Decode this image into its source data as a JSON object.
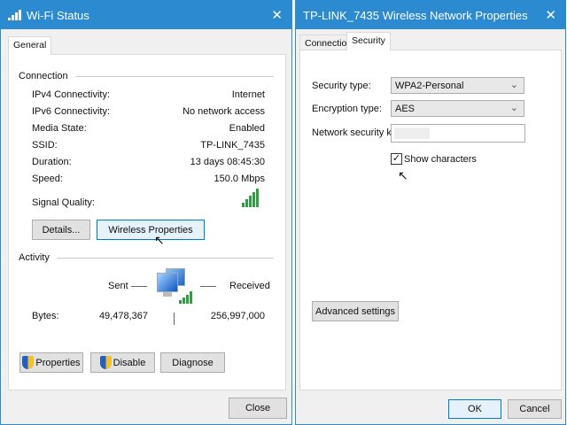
{
  "status": {
    "title": "Wi-Fi Status",
    "tab": "General",
    "connection_label": "Connection",
    "rows": [
      {
        "label": "IPv4 Connectivity:",
        "value": "Internet"
      },
      {
        "label": "IPv6 Connectivity:",
        "value": "No network access"
      },
      {
        "label": "Media State:",
        "value": "Enabled"
      },
      {
        "label": "SSID:",
        "value": "TP-LINK_7435"
      },
      {
        "label": "Duration:",
        "value": "13 days 08:45:30"
      },
      {
        "label": "Speed:",
        "value": "150.0 Mbps"
      }
    ],
    "signal_label": "Signal Quality:",
    "signal_bars": 5,
    "details_button": "Details...",
    "wireless_button": "Wireless Properties",
    "activity_label": "Activity",
    "sent_label": "Sent",
    "received_label": "Received",
    "bytes_label": "Bytes:",
    "bytes_sent": "49,478,367",
    "bytes_received": "256,997,000",
    "properties_button": "Properties",
    "disable_button": "Disable",
    "diagnose_button": "Diagnose",
    "close_button": "Close"
  },
  "props": {
    "title": "TP-LINK_7435 Wireless Network Properties",
    "tabs": [
      "Connection",
      "Security"
    ],
    "security_type_label": "Security type:",
    "security_type": "WPA2-Personal",
    "encryption_type_label": "Encryption type:",
    "encryption_type": "AES",
    "key_label": "Network security key",
    "show_characters": "Show characters",
    "show_characters_checked": true,
    "advanced_button": "Advanced settings",
    "ok_button": "OK",
    "cancel_button": "Cancel"
  },
  "colors": {
    "titlebar": "#2b8ad0",
    "signal": "#2f9e44"
  }
}
